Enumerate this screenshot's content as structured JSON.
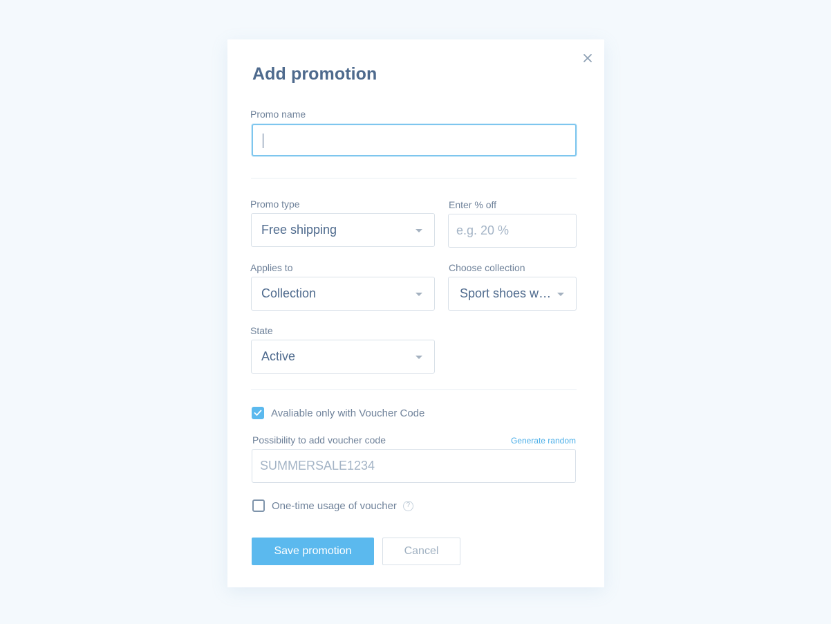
{
  "dialog": {
    "title": "Add promotion",
    "close_icon": "close-icon"
  },
  "promo_name": {
    "label": "Promo name",
    "value": ""
  },
  "promo_type": {
    "label": "Promo type",
    "selected": "Free shipping"
  },
  "percent_off": {
    "label": "Enter % off",
    "placeholder": "e.g. 20 %"
  },
  "applies_to": {
    "label": "Applies to",
    "selected": "Collection"
  },
  "collection": {
    "label": "Choose collection",
    "selected": "Sport shoes with sale"
  },
  "state": {
    "label": "State",
    "selected": "Active"
  },
  "voucher_only": {
    "label": "Avaliable only with Voucher Code",
    "checked": true
  },
  "voucher_code": {
    "label": "Possibility to add voucher code",
    "generate_label": "Generate random",
    "placeholder": "SUMMERSALE1234"
  },
  "one_time": {
    "label": "One-time usage of voucher",
    "checked": false,
    "help_glyph": "?"
  },
  "actions": {
    "save_label": "Save promotion",
    "cancel_label": "Cancel"
  },
  "colors": {
    "accent": "#5bb9ee",
    "title": "#4e6a8d",
    "label": "#6f829a",
    "background": "#f4f9fd"
  }
}
